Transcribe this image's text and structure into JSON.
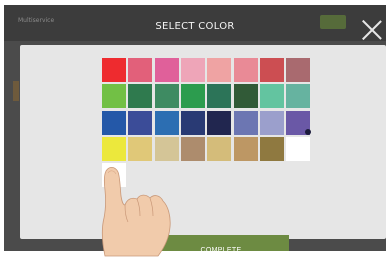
{
  "background": {
    "title": "Multiservice"
  },
  "dialog": {
    "title": "SELECT COLOR",
    "close_icon": "close-icon",
    "complete_label": "COMPLETE",
    "selected_swatch": "#6a58a6"
  },
  "palette": {
    "rows": [
      [
        "#ee2b2f",
        "#e2607a",
        "#e0609a",
        "#eea5b8",
        "#efa3a3",
        "#e98a96",
        "#cc4e52",
        "#a96a6f"
      ],
      [
        "#72c045",
        "#2f7a4e",
        "#3e8b62",
        "#2c9c4e",
        "#2c7458",
        "#315a37",
        "#63c4a0",
        "#66b3a0"
      ],
      [
        "#2458a8",
        "#3b4c98",
        "#2c6eb2",
        "#293a74",
        "#21264f",
        "#6c76b2",
        "#9b9fcc",
        "#6a58a6"
      ],
      [
        "#ece83c",
        "#e0c878",
        "#d4c597",
        "#ad8c6d",
        "#d4bc7a",
        "#bd9764",
        "#8f7940",
        "#ffffff"
      ],
      [
        "#ffffff"
      ]
    ]
  },
  "icons": {
    "hand": "pointing-hand-icon"
  }
}
